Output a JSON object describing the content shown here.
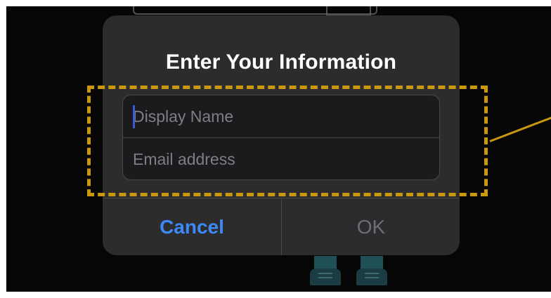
{
  "dialog": {
    "title": "Enter Your Information",
    "display_name_placeholder": "Display Name",
    "display_name_value": "",
    "email_placeholder": "Email address",
    "email_value": "",
    "cancel_label": "Cancel",
    "ok_label": "OK"
  },
  "colors": {
    "accent": "#3d8af7",
    "annotation": "#c9980c",
    "disabled_text": "#6d6d72",
    "caret": "#3a5bd9"
  },
  "annotation": {
    "style": "dashed-highlight-with-callout-line",
    "target": "text-fields"
  },
  "background_icons": [
    "shirt-outline-icon",
    "shoe-icon",
    "shoe-icon"
  ]
}
